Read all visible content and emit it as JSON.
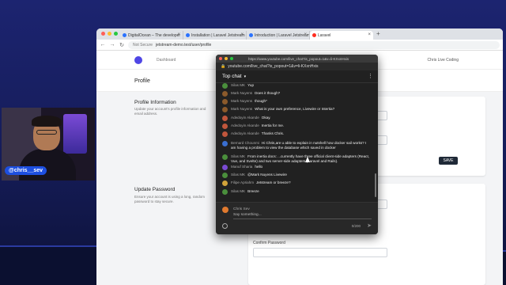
{
  "browser": {
    "tabs": [
      {
        "label": "DigitalOcean – The developer",
        "active": false
      },
      {
        "label": "Installation | Laravel Jetstream",
        "active": false
      },
      {
        "label": "Introduction | Laravel Jetstream",
        "active": false
      },
      {
        "label": "Laravel",
        "active": true
      }
    ],
    "not_secure": "Not Secure",
    "url": "jetstream-demo.test/user/profile"
  },
  "app": {
    "nav_link": "Dashboard",
    "user_name": "Chris Live Coding",
    "page_title": "Profile",
    "profile_info_title": "Profile Information",
    "profile_info_sub": "Update your account's profile information and email address.",
    "save_button": "SAVE",
    "update_password_title": "Update Password",
    "update_password_sub": "Ensure your account is using a long, random password to stay secure.",
    "confirm_password_label": "Confirm Password"
  },
  "webcam": {
    "handle": "@chris__sev"
  },
  "chat_popup": {
    "window_url": "https://www.youtube.com/live_chat?is_popout=1&v=li-KXxnHxis",
    "address": "youtube.com/live_chat?is_popout=1&v=li-KXxnHxis",
    "header": "Top chat",
    "messages": [
      {
        "author": "Silas MK",
        "text": "Yup",
        "color": "#4a8f3c"
      },
      {
        "author": "Mark Nuyens",
        "text": "Does it though?",
        "color": "#8b5a2b"
      },
      {
        "author": "Mark Nuyens",
        "text": "though*",
        "color": "#8b5a2b"
      },
      {
        "author": "Mark Nuyens",
        "text": "What is your own preference, Livewire or Intertia?",
        "color": "#8b5a2b"
      },
      {
        "author": "Adedoyin Akande",
        "text": "Okay.",
        "color": "#c0563c"
      },
      {
        "author": "Adedoyin Akande",
        "text": "Inertia for me.",
        "color": "#c0563c"
      },
      {
        "author": "Adedoyin Akande",
        "text": "Thanks Chris.",
        "color": "#c0563c"
      },
      {
        "author": "Bernard Chounmi",
        "text": "Hi Chris,are u able to explain in nutshell how docker sail works? I am having a problem to view the database which saved in docker",
        "color": "#3a6fd1"
      },
      {
        "author": "Silas MK",
        "text": "From inertia docs: ...currently have three official client-side adapters (React, Vue, and Svelte) and two server-side adapters (Laravel and Rails).",
        "color": "#4a8f3c"
      },
      {
        "author": "Manuf Sharia",
        "text": "hello",
        "color": "#7a4bd3"
      },
      {
        "author": "Silas MK",
        "text": "@Mark Nuyens Livewire",
        "color": "#4a8f3c"
      },
      {
        "author": "Filipe Apriahm",
        "text": "Jetstream or breeze?",
        "color": "#d1a33a"
      },
      {
        "author": "Silas MK",
        "text": "Breeze",
        "color": "#4a8f3c"
      }
    ],
    "input_name": "Chris Sev",
    "input_placeholder": "Say something...",
    "char_count": "0/200"
  }
}
